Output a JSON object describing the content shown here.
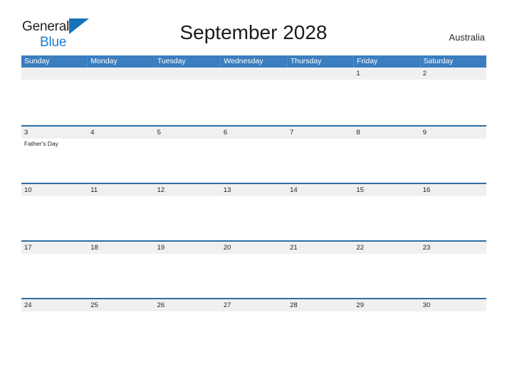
{
  "brand": {
    "logo_text_top": "General",
    "logo_text_bottom": "Blue",
    "logo_triangle_icon": "blue-triangle-icon",
    "colors": {
      "logo_dark": "#231f20",
      "logo_blue": "#1b7fd4",
      "triangle_blue": "#1573bb"
    }
  },
  "header": {
    "title": "September 2028",
    "country": "Australia"
  },
  "calendar": {
    "colors": {
      "header_row_background": "#3b7ebf",
      "header_row_text": "#ffffff",
      "date_band_background": "#f0f0f0",
      "week_separator": "#2e6da4",
      "page_background": "#ffffff",
      "text": "#1f1f1f"
    },
    "day_names": [
      "Sunday",
      "Monday",
      "Tuesday",
      "Wednesday",
      "Thursday",
      "Friday",
      "Saturday"
    ],
    "weeks": [
      {
        "days": [
          {
            "date": "",
            "events": []
          },
          {
            "date": "",
            "events": []
          },
          {
            "date": "",
            "events": []
          },
          {
            "date": "",
            "events": []
          },
          {
            "date": "",
            "events": []
          },
          {
            "date": "1",
            "events": []
          },
          {
            "date": "2",
            "events": []
          }
        ]
      },
      {
        "days": [
          {
            "date": "3",
            "events": [
              "Father's Day"
            ]
          },
          {
            "date": "4",
            "events": []
          },
          {
            "date": "5",
            "events": []
          },
          {
            "date": "6",
            "events": []
          },
          {
            "date": "7",
            "events": []
          },
          {
            "date": "8",
            "events": []
          },
          {
            "date": "9",
            "events": []
          }
        ]
      },
      {
        "days": [
          {
            "date": "10",
            "events": []
          },
          {
            "date": "11",
            "events": []
          },
          {
            "date": "12",
            "events": []
          },
          {
            "date": "13",
            "events": []
          },
          {
            "date": "14",
            "events": []
          },
          {
            "date": "15",
            "events": []
          },
          {
            "date": "16",
            "events": []
          }
        ]
      },
      {
        "days": [
          {
            "date": "17",
            "events": []
          },
          {
            "date": "18",
            "events": []
          },
          {
            "date": "19",
            "events": []
          },
          {
            "date": "20",
            "events": []
          },
          {
            "date": "21",
            "events": []
          },
          {
            "date": "22",
            "events": []
          },
          {
            "date": "23",
            "events": []
          }
        ]
      },
      {
        "days": [
          {
            "date": "24",
            "events": []
          },
          {
            "date": "25",
            "events": []
          },
          {
            "date": "26",
            "events": []
          },
          {
            "date": "27",
            "events": []
          },
          {
            "date": "28",
            "events": []
          },
          {
            "date": "29",
            "events": []
          },
          {
            "date": "30",
            "events": []
          }
        ]
      }
    ]
  }
}
